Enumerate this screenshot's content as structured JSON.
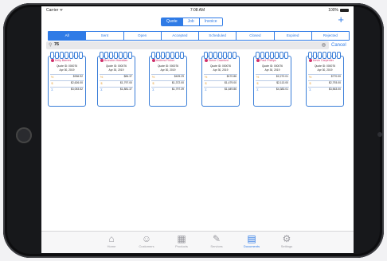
{
  "status": {
    "carrier": "Carrier ᯤ",
    "time": "7:08 AM",
    "battery": "100%"
  },
  "top_segment": [
    {
      "label": "Quote",
      "active": true
    },
    {
      "label": "Job",
      "active": false
    },
    {
      "label": "Invoice",
      "active": false
    }
  ],
  "add_label": "+",
  "filters": [
    {
      "label": "All",
      "active": true
    },
    {
      "label": "Sent",
      "active": false
    },
    {
      "label": "Open",
      "active": false
    },
    {
      "label": "Accepted",
      "active": false
    },
    {
      "label": "Scheduled",
      "active": false
    },
    {
      "label": "Closed",
      "active": false
    },
    {
      "label": "Expired",
      "active": false
    },
    {
      "label": "Rejected",
      "active": false
    }
  ],
  "search": {
    "icon": "search-icon",
    "value": "76",
    "cancel_label": "Cancel"
  },
  "cards": [
    {
      "name": "Kelly Barnes",
      "quote": "Quote ID: 000076",
      "date": "Apr 30, 2019",
      "v1": "$336.92",
      "v2": "$2,626.00",
      "v3": "$3,053.52"
    },
    {
      "name": "Brandon Hawaiian",
      "quote": "Quote ID: 000076",
      "date": "Apr 30, 2019",
      "v1": "$84.37",
      "v2": "$1,797.00",
      "v3": "$1,881.37"
    },
    {
      "name": "Andrew Fisher",
      "quote": "Quote ID: 000076",
      "date": "Apr 30, 2019",
      "v1": "$425.29",
      "v2": "$1,372.00",
      "v3": "$1,797.39"
    },
    {
      "name": "Steve Crawford",
      "quote": "Quote ID: 000076",
      "date": "Apr 30, 2019",
      "v1": "$170.86",
      "v2": "$1,479.00",
      "v3": "$1,649.86"
    },
    {
      "name": "Paul Phillips",
      "quote": "Quote ID: 000076",
      "date": "Apr 30, 2019",
      "v1": "$2,270.01",
      "v2": "$2,113.00",
      "v3": "$4,383.01"
    },
    {
      "name": "Kevin Carpenter",
      "quote": "Quote ID: 000076",
      "date": "Apr 30, 2019",
      "v1": "$770.00",
      "v2": "$2,793.00",
      "v3": "$3,563.00"
    }
  ],
  "tabs": [
    {
      "label": "Home",
      "icon": "home-icon",
      "glyph": "⌂",
      "active": false
    },
    {
      "label": "Customers",
      "icon": "customers-icon",
      "glyph": "☺",
      "active": false
    },
    {
      "label": "Products",
      "icon": "products-icon",
      "glyph": "▦",
      "active": false
    },
    {
      "label": "Services",
      "icon": "services-icon",
      "glyph": "✎",
      "active": false
    },
    {
      "label": "Documents",
      "icon": "documents-icon",
      "glyph": "▤",
      "active": true
    },
    {
      "label": "Settings",
      "icon": "settings-icon",
      "glyph": "⚙",
      "active": false
    }
  ]
}
